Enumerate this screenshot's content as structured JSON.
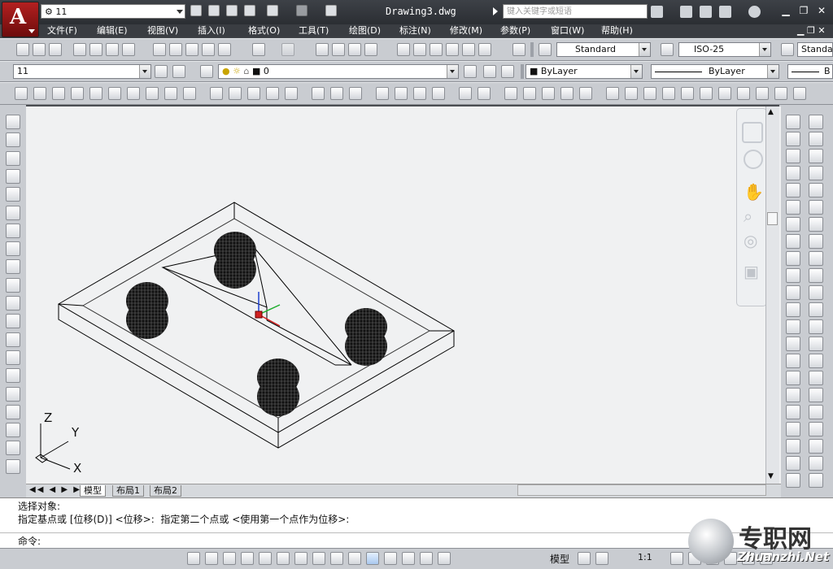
{
  "title_bar": {
    "workspace": "11",
    "document_title": "Drawing3.dwg",
    "search_placeholder": "键入关键字或短语"
  },
  "menu": {
    "items": [
      "文件(F)",
      "编辑(E)",
      "视图(V)",
      "插入(I)",
      "格式(O)",
      "工具(T)",
      "绘图(D)",
      "标注(N)",
      "修改(M)",
      "参数(P)",
      "窗口(W)",
      "帮助(H)"
    ]
  },
  "styles": {
    "text_style": "Standard",
    "dim_style": "ISO-25",
    "table_style": "Standa"
  },
  "layers": {
    "workspace": "11",
    "current_layer": "0",
    "color": "ByLayer",
    "linetype": "ByLayer",
    "lineweight": "B"
  },
  "ucs_icon": {
    "z": "Z",
    "y": "Y",
    "x": "X"
  },
  "layout_tabs": [
    "模型",
    "布局1",
    "布局2"
  ],
  "command": {
    "line1": "选择对象:",
    "line2": "指定基点或 [位移(D)] <位移>:  指定第二个点或 <使用第一个点作为位移>:",
    "prompt": "命令:"
  },
  "status_bar": {
    "space": "模型",
    "scale": "1:1"
  },
  "watermark": {
    "text": "专职网",
    "url": "Zhuanzhi.Net"
  },
  "colors": {
    "title_bg": "#2e3136",
    "toolbar_bg": "#c9ccd1",
    "canvas_bg": "#f0f1f2",
    "app_red": "#a51c1c"
  }
}
